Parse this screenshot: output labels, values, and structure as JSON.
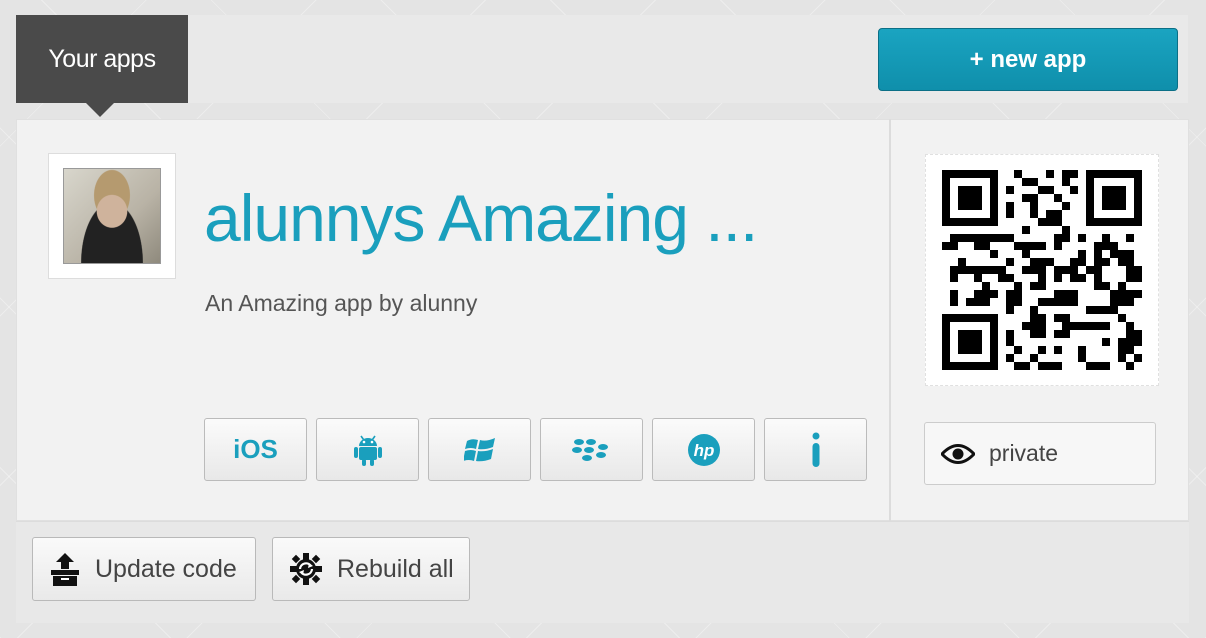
{
  "header": {
    "tab_label": "Your apps",
    "new_app_label": "+ new app"
  },
  "app": {
    "title": "alunnys Amazing ...",
    "description": "An Amazing app by alunny",
    "platforms": [
      {
        "label": "iOS",
        "icon": "apple-ios-text"
      },
      {
        "label": "",
        "icon": "android-icon"
      },
      {
        "label": "",
        "icon": "windows-icon"
      },
      {
        "label": "",
        "icon": "blackberry-icon"
      },
      {
        "label": "",
        "icon": "hp-webos-icon"
      },
      {
        "label": "",
        "icon": "info-icon"
      }
    ],
    "privacy_label": "private"
  },
  "footer": {
    "update_label": "Update code",
    "rebuild_label": "Rebuild all"
  },
  "colors": {
    "accent": "#1a9fbd",
    "tab_bg": "#4a4a4a",
    "new_app_bg": "#1399b6"
  }
}
